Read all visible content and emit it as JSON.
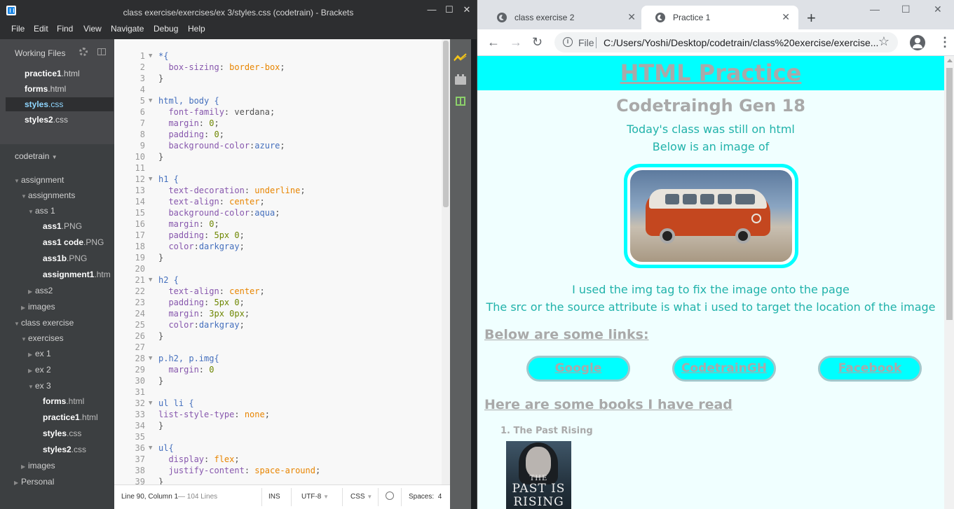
{
  "brackets": {
    "window_title": "class exercise/exercises/ex 3/styles.css (codetrain) - Brackets",
    "window_buttons": [
      "—",
      "☐",
      "✕"
    ],
    "menu": [
      "File",
      "Edit",
      "Find",
      "View",
      "Navigate",
      "Debug",
      "Help"
    ],
    "working_files": {
      "header": "Working Files",
      "files": [
        {
          "name": "practice1",
          "ext": ".html",
          "selected": false
        },
        {
          "name": "forms",
          "ext": ".html",
          "selected": false
        },
        {
          "name": "styles",
          "ext": ".css",
          "selected": true
        },
        {
          "name": "styles2",
          "ext": ".css",
          "selected": false
        }
      ]
    },
    "project": {
      "name": "codetrain",
      "tree": [
        {
          "label": "assignment",
          "type": "folder",
          "open": true
        },
        {
          "label": "assignments",
          "type": "folder",
          "open": true
        },
        {
          "label": "ass 1",
          "type": "folder",
          "open": true
        },
        {
          "label": "ass1",
          "ext": ".PNG",
          "type": "file"
        },
        {
          "label": "ass1 code",
          "ext": ".PNG",
          "type": "file"
        },
        {
          "label": "ass1b",
          "ext": ".PNG",
          "type": "file"
        },
        {
          "label": "assignment1",
          "ext": ".htm",
          "type": "file"
        },
        {
          "label": "ass2",
          "type": "folder",
          "open": false
        },
        {
          "label": "images",
          "type": "folder",
          "open": false
        },
        {
          "label": "class exercise",
          "type": "folder",
          "open": true
        },
        {
          "label": "exercises",
          "type": "folder",
          "open": true
        },
        {
          "label": "ex 1",
          "type": "folder",
          "open": false
        },
        {
          "label": "ex 2",
          "type": "folder",
          "open": false
        },
        {
          "label": "ex 3",
          "type": "folder",
          "open": true
        },
        {
          "label": "forms",
          "ext": ".html",
          "type": "file"
        },
        {
          "label": "practice1",
          "ext": ".html",
          "type": "file"
        },
        {
          "label": "styles",
          "ext": ".css",
          "type": "file"
        },
        {
          "label": "styles2",
          "ext": ".css",
          "type": "file"
        },
        {
          "label": "images",
          "type": "folder",
          "open": false
        },
        {
          "label": "Personal",
          "type": "folder",
          "open": false
        }
      ]
    },
    "code_lines": [
      [
        {
          "t": "*{",
          "c": "sel"
        }
      ],
      [
        {
          "t": "  box-sizing",
          "c": "prop"
        },
        {
          "t": ": "
        },
        {
          "t": "border-box",
          "c": "val"
        },
        {
          "t": ";"
        }
      ],
      [
        {
          "t": "}"
        }
      ],
      [],
      [
        {
          "t": "html, body {",
          "c": "sel"
        }
      ],
      [
        {
          "t": "  font-family",
          "c": "prop2"
        },
        {
          "t": ": verdana;"
        }
      ],
      [
        {
          "t": "  margin",
          "c": "prop2"
        },
        {
          "t": ": "
        },
        {
          "t": "0",
          "c": "num"
        },
        {
          "t": ";"
        }
      ],
      [
        {
          "t": "  padding",
          "c": "prop2"
        },
        {
          "t": ": "
        },
        {
          "t": "0",
          "c": "num"
        },
        {
          "t": ";"
        }
      ],
      [
        {
          "t": "  background-color",
          "c": "prop2"
        },
        {
          "t": ":"
        },
        {
          "t": "azure",
          "c": "sel"
        },
        {
          "t": ";"
        }
      ],
      [
        {
          "t": "}"
        }
      ],
      [],
      [
        {
          "t": "h1 {",
          "c": "sel"
        }
      ],
      [
        {
          "t": "  text-decoration",
          "c": "prop2"
        },
        {
          "t": ": "
        },
        {
          "t": "underline",
          "c": "val"
        },
        {
          "t": ";"
        }
      ],
      [
        {
          "t": "  text-align",
          "c": "prop2"
        },
        {
          "t": ": "
        },
        {
          "t": "center",
          "c": "val"
        },
        {
          "t": ";"
        }
      ],
      [
        {
          "t": "  background-color",
          "c": "prop2"
        },
        {
          "t": ":"
        },
        {
          "t": "aqua",
          "c": "sel"
        },
        {
          "t": ";"
        }
      ],
      [
        {
          "t": "  margin",
          "c": "prop2"
        },
        {
          "t": ": "
        },
        {
          "t": "0",
          "c": "num"
        },
        {
          "t": ";"
        }
      ],
      [
        {
          "t": "  padding",
          "c": "prop2"
        },
        {
          "t": ": "
        },
        {
          "t": "5px 0",
          "c": "num"
        },
        {
          "t": ";"
        }
      ],
      [
        {
          "t": "  color",
          "c": "prop2"
        },
        {
          "t": ":"
        },
        {
          "t": "darkgray",
          "c": "sel"
        },
        {
          "t": ";"
        }
      ],
      [
        {
          "t": "}"
        }
      ],
      [],
      [
        {
          "t": "h2 {",
          "c": "sel"
        }
      ],
      [
        {
          "t": "  text-align",
          "c": "prop2"
        },
        {
          "t": ": "
        },
        {
          "t": "center",
          "c": "val"
        },
        {
          "t": ";"
        }
      ],
      [
        {
          "t": "  padding",
          "c": "prop2"
        },
        {
          "t": ": "
        },
        {
          "t": "5px 0",
          "c": "num"
        },
        {
          "t": ";"
        }
      ],
      [
        {
          "t": "  margin",
          "c": "prop2"
        },
        {
          "t": ": "
        },
        {
          "t": "3px 0px",
          "c": "num"
        },
        {
          "t": ";"
        }
      ],
      [
        {
          "t": "  color",
          "c": "prop2"
        },
        {
          "t": ":"
        },
        {
          "t": "darkgray",
          "c": "sel"
        },
        {
          "t": ";"
        }
      ],
      [
        {
          "t": "}"
        }
      ],
      [],
      [
        {
          "t": "p.h2, p.img{",
          "c": "sel"
        }
      ],
      [
        {
          "t": "  margin",
          "c": "prop2"
        },
        {
          "t": ": "
        },
        {
          "t": "0",
          "c": "num"
        }
      ],
      [
        {
          "t": "}"
        }
      ],
      [],
      [
        {
          "t": "ul li {",
          "c": "sel"
        }
      ],
      [
        {
          "t": "list-style-type",
          "c": "prop2"
        },
        {
          "t": ": "
        },
        {
          "t": "none",
          "c": "val"
        },
        {
          "t": ";"
        }
      ],
      [
        {
          "t": "}"
        }
      ],
      [],
      [
        {
          "t": "ul{",
          "c": "sel"
        }
      ],
      [
        {
          "t": "  display",
          "c": "prop2"
        },
        {
          "t": ": "
        },
        {
          "t": "flex",
          "c": "val"
        },
        {
          "t": ";"
        }
      ],
      [
        {
          "t": "  justify-content",
          "c": "prop2"
        },
        {
          "t": ": "
        },
        {
          "t": "space-around",
          "c": "val"
        },
        {
          "t": ";"
        }
      ],
      [
        {
          "t": "}"
        }
      ]
    ],
    "fold_lines": [
      1,
      5,
      12,
      21,
      28,
      32,
      36
    ],
    "status": {
      "cursor": "Line 90, Column 1",
      "lines": " — 104 Lines",
      "mode": "INS",
      "encoding": "UTF-8",
      "language": "CSS",
      "spaces_label": "Spaces:",
      "spaces_value": "4"
    },
    "colors": {
      "accent_selected": "#8fd6ff",
      "live_preview": "#f5c518"
    }
  },
  "chrome": {
    "tabs": [
      {
        "title": "class exercise 2",
        "active": false
      },
      {
        "title": "Practice 1",
        "active": true
      }
    ],
    "new_tab": "+",
    "window_buttons": [
      "—",
      "☐",
      "✕"
    ],
    "nav": {
      "back": "←",
      "forward": "→",
      "reload": "↻"
    },
    "omnibox": {
      "scheme": "File",
      "url": "C:/Users/Yoshi/Desktop/codetrain/class%20exercise/exercise...",
      "star": "☆"
    },
    "menu_icon": "⋮",
    "page": {
      "h1": "HTML Practice",
      "h2": "Codetraingh Gen 18",
      "p1": "Today's class was still on html",
      "p2": "Below is an image of",
      "p3": "I used the img tag to fix the image onto the page",
      "p4": "The src or the source attribute is what i used to target the location of the image",
      "links_heading": "Below are some links:",
      "links": [
        "Google",
        "CodetrainGH",
        "Facebook"
      ],
      "books_heading": "Here are some books I have read",
      "books": [
        {
          "number": "1.",
          "title": "The Past Rising"
        }
      ],
      "cover_lines": [
        "THE",
        "PAST IS",
        "RISING"
      ]
    }
  }
}
